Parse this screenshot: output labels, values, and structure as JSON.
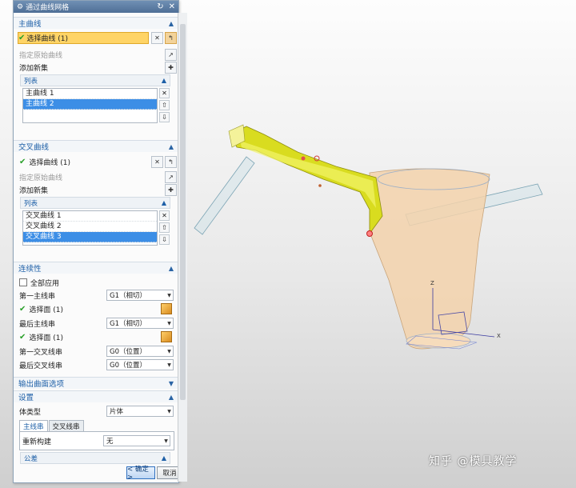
{
  "dialog": {
    "title": "通过曲线网格"
  },
  "primary": {
    "header": "主曲线",
    "select_label": "选择曲线 (1)",
    "specify_origin": "指定原始曲线",
    "add_new_set": "添加新集",
    "list_header": "列表",
    "items": [
      "主曲线 1",
      "主曲线 2"
    ],
    "selected_index": 1
  },
  "cross": {
    "header": "交叉曲线",
    "select_label": "选择曲线 (1)",
    "specify_origin": "指定原始曲线",
    "add_new_set": "添加新集",
    "list_header": "列表",
    "items": [
      "交叉曲线 1",
      "交叉曲线 2",
      "交叉曲线 3"
    ],
    "selected_index": 2
  },
  "continuity": {
    "header": "连续性",
    "apply_all": "全部应用",
    "first_primary": "第一主线串",
    "first_primary_value": "G1（相切）",
    "select_face_1": "选择面 (1)",
    "last_primary": "最后主线串",
    "last_primary_value": "G1（相切）",
    "select_face_2": "选择面 (1)",
    "first_cross": "第一交叉线串",
    "first_cross_value": "G0（位置）",
    "last_cross": "最后交叉线串",
    "last_cross_value": "G0（位置）"
  },
  "output": {
    "header": "输出曲面选项"
  },
  "settings": {
    "header": "设置",
    "body_type_label": "体类型",
    "body_type_value": "片体",
    "tab_primary": "主线串",
    "tab_cross": "交叉线串",
    "rebuild_label": "重新构建",
    "rebuild_value": "无",
    "tolerance_header": "公差"
  },
  "buttons": {
    "ok": "< 确定 >",
    "cancel": "取消"
  },
  "viewport": {
    "axis_x": "X",
    "axis_z": "Z"
  },
  "watermark": "知乎 @模具教学",
  "colors": {
    "selection": "#ffd466",
    "list_selected": "#3c8ee6",
    "section_text": "#1d5fa7",
    "surface_yellow": "#d9dc1f",
    "body_peach": "#f3d2ab"
  }
}
